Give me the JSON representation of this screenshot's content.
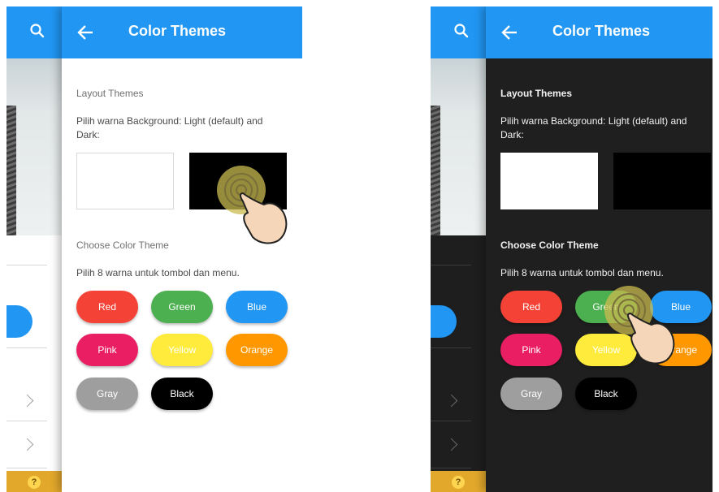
{
  "header": {
    "back_label": "←",
    "title": "Color Themes"
  },
  "layout_section": {
    "title": "Layout Themes",
    "description": "Pilih warna Background: Light (default) and Dark:",
    "options": [
      "Light",
      "Dark"
    ]
  },
  "color_section": {
    "title": "Choose Color Theme",
    "description": "Pilih 8 warna untuk tombol dan menu.",
    "buttons": [
      {
        "label": "Red",
        "color": "#f44336"
      },
      {
        "label": "Green",
        "color": "#4caf50"
      },
      {
        "label": "Blue",
        "color": "#2196f3"
      },
      {
        "label": "Pink",
        "color": "#e91e63"
      },
      {
        "label": "Yellow",
        "color": "#ffeb3b"
      },
      {
        "label": "Orange",
        "color": "#ff9800"
      },
      {
        "label": "Gray",
        "color": "#9e9e9e"
      },
      {
        "label": "Black",
        "color": "#000000"
      }
    ]
  },
  "background_app": {
    "help_label": "?"
  },
  "colors": {
    "accent": "#2196f3",
    "dark_bg": "#1f1f1f",
    "footer": "#e2a82b"
  }
}
